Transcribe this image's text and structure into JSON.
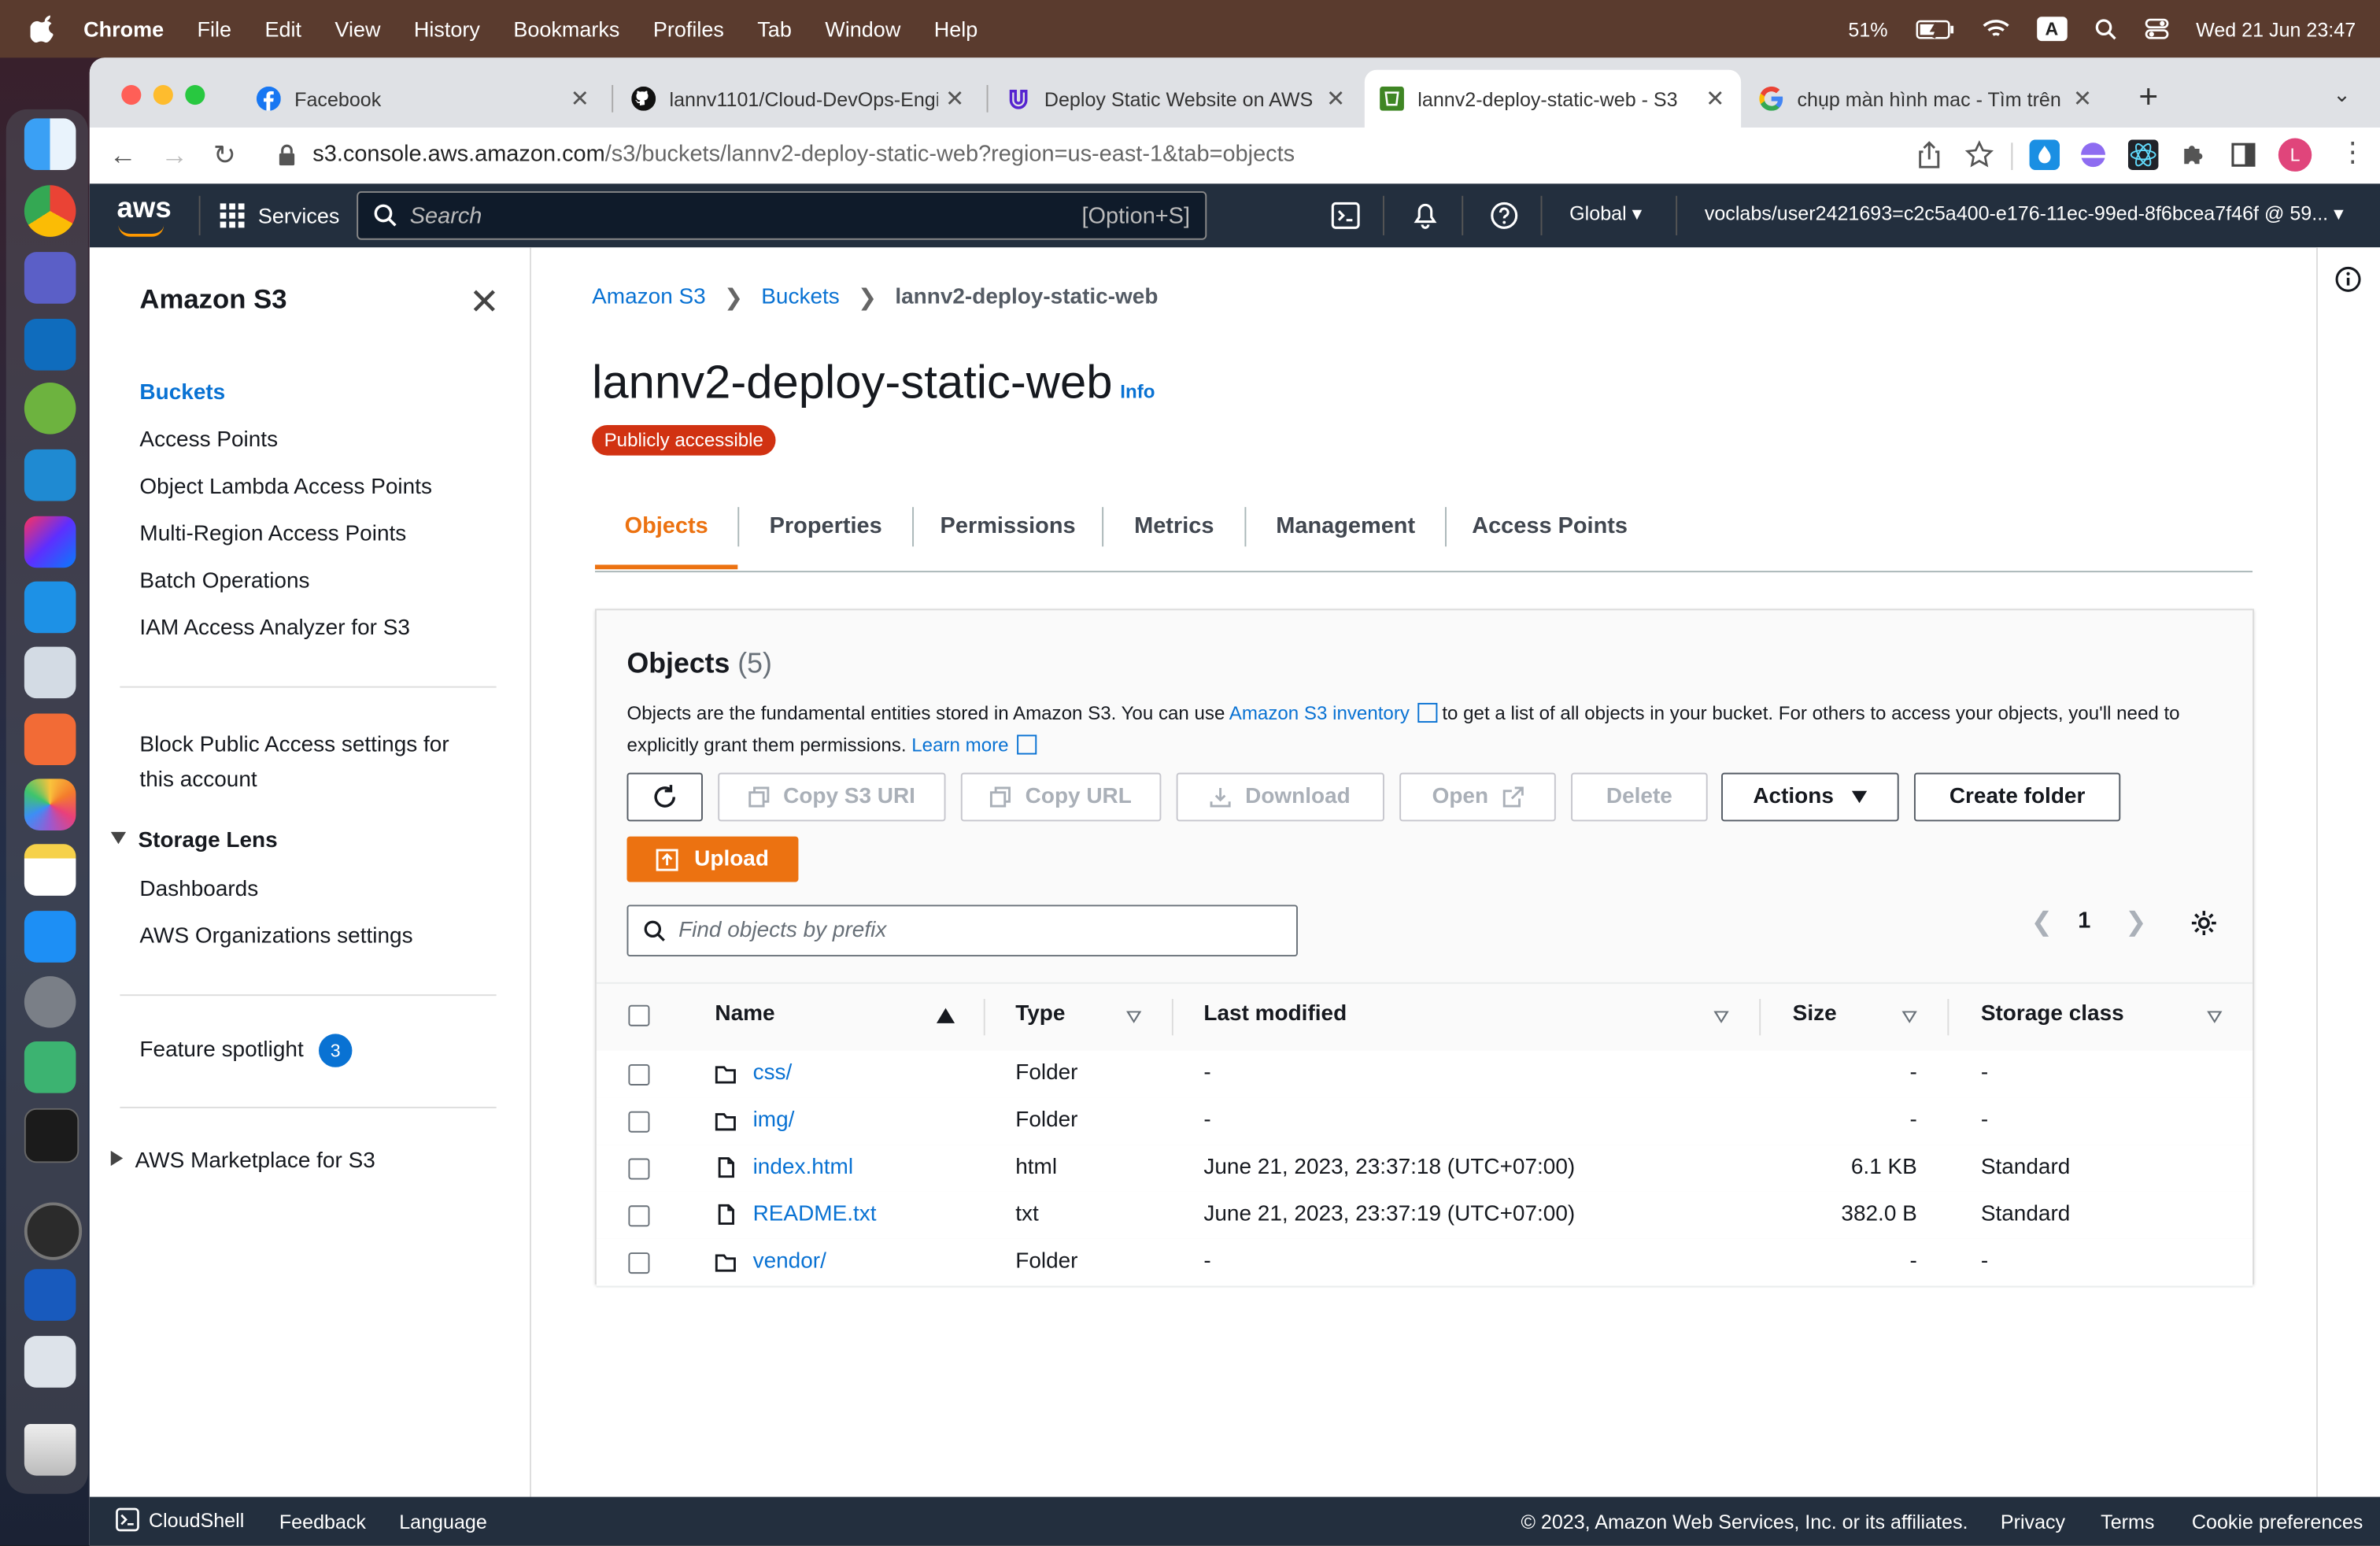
{
  "menubar": {
    "app": "Chrome",
    "items": [
      "File",
      "Edit",
      "View",
      "History",
      "Bookmarks",
      "Profiles",
      "Tab",
      "Window",
      "Help"
    ],
    "battery": "51%",
    "input_badge": "A",
    "datetime": "Wed 21 Jun  23:47"
  },
  "browser": {
    "tabs": [
      {
        "title": "Facebook"
      },
      {
        "title": "lannv1101/Cloud-DevOps-Engi"
      },
      {
        "title": "Deploy Static Website on AWS"
      },
      {
        "title": "lannv2-deploy-static-web - S3"
      },
      {
        "title": "chụp màn hình mac - Tìm trên"
      }
    ],
    "url_host": "s3.console.aws.amazon.com",
    "url_path": "/s3/buckets/lannv2-deploy-static-web?region=us-east-1&tab=objects",
    "profile_initial": "L"
  },
  "aws_header": {
    "logo": "aws",
    "services": "Services",
    "search_placeholder": "Search",
    "search_shortcut": "[Option+S]",
    "region": "Global",
    "account": "voclabs/user2421693=c2c5a400-e176-11ec-99ed-8f6bcea7f46f @ 59..."
  },
  "sidebar": {
    "title": "Amazon S3",
    "items": [
      "Buckets",
      "Access Points",
      "Object Lambda Access Points",
      "Multi-Region Access Points",
      "Batch Operations",
      "IAM Access Analyzer for S3"
    ],
    "block_public": "Block Public Access settings for this account",
    "storage_lens": "Storage Lens",
    "storage_lens_items": [
      "Dashboards",
      "AWS Organizations settings"
    ],
    "feature_spotlight": "Feature spotlight",
    "feature_count": "3",
    "marketplace": "AWS Marketplace for S3"
  },
  "breadcrumb": [
    "Amazon S3",
    "Buckets",
    "lannv2-deploy-static-web"
  ],
  "bucket": {
    "name": "lannv2-deploy-static-web",
    "info": "Info",
    "badge": "Publicly accessible"
  },
  "tabs": [
    "Objects",
    "Properties",
    "Permissions",
    "Metrics",
    "Management",
    "Access Points"
  ],
  "objects_panel": {
    "title": "Objects",
    "count": "(5)",
    "desc1": "Objects are the fundamental entities stored in Amazon S3. You can use ",
    "inventory_link": "Amazon S3 inventory",
    "desc2": " to get a list of all objects in your bucket. For others to access your objects, you'll need to explicitly grant them permissions. ",
    "learn_more": "Learn more",
    "buttons": {
      "copy_uri": "Copy S3 URI",
      "copy_url": "Copy URL",
      "download": "Download",
      "open": "Open",
      "delete": "Delete",
      "actions": "Actions",
      "create_folder": "Create folder",
      "upload": "Upload"
    },
    "find_placeholder": "Find objects by prefix",
    "page": "1",
    "columns": [
      "Name",
      "Type",
      "Last modified",
      "Size",
      "Storage class"
    ],
    "rows": [
      {
        "name": "css/",
        "type": "Folder",
        "modified": "-",
        "size": "-",
        "storage": "-",
        "kind": "folder"
      },
      {
        "name": "img/",
        "type": "Folder",
        "modified": "-",
        "size": "-",
        "storage": "-",
        "kind": "folder"
      },
      {
        "name": "index.html",
        "type": "html",
        "modified": "June 21, 2023, 23:37:18 (UTC+07:00)",
        "size": "6.1 KB",
        "storage": "Standard",
        "kind": "file"
      },
      {
        "name": "README.txt",
        "type": "txt",
        "modified": "June 21, 2023, 23:37:19 (UTC+07:00)",
        "size": "382.0 B",
        "storage": "Standard",
        "kind": "file"
      },
      {
        "name": "vendor/",
        "type": "Folder",
        "modified": "-",
        "size": "-",
        "storage": "-",
        "kind": "folder"
      }
    ]
  },
  "footer": {
    "cloudshell": "CloudShell",
    "feedback": "Feedback",
    "language": "Language",
    "copyright": "© 2023, Amazon Web Services, Inc. or its affiliates.",
    "privacy": "Privacy",
    "terms": "Terms",
    "cookies": "Cookie preferences"
  },
  "colors": {
    "aws_dark": "#232f3e",
    "aws_orange": "#ec7211",
    "link_blue": "#0972d3",
    "public_red": "#d13212"
  }
}
